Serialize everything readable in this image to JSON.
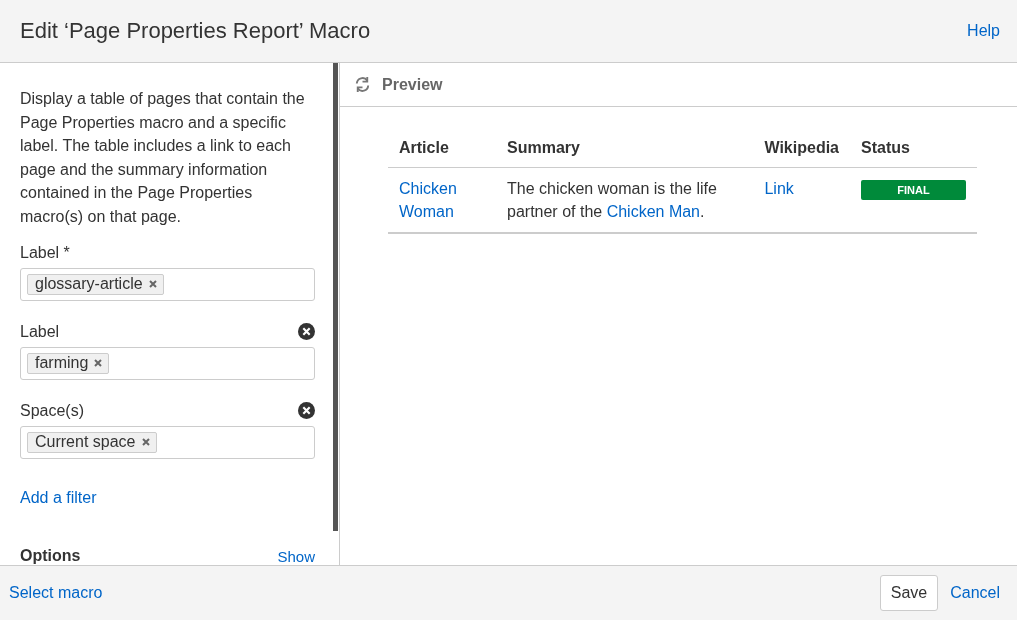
{
  "dialog": {
    "title": "Edit ‘Page Properties Report’ Macro",
    "help": "Help"
  },
  "sidebar": {
    "description": "Display a table of pages that contain the Page Properties macro and a specific label. The table includes a link to each page and the summary information contained in the Page Properties macro(s) on that page.",
    "fields": [
      {
        "label": "Label *",
        "removable": false,
        "tokens": [
          "glossary-article"
        ]
      },
      {
        "label": "Label",
        "removable": true,
        "tokens": [
          "farming"
        ]
      },
      {
        "label": "Space(s)",
        "removable": true,
        "tokens": [
          "Current space"
        ]
      }
    ],
    "add_filter": "Add a filter",
    "options": {
      "title": "Options",
      "toggle": "Show"
    }
  },
  "preview": {
    "title": "Preview",
    "table": {
      "columns": [
        "Article",
        "Summary",
        "Wikipedia",
        "Status"
      ],
      "rows": [
        {
          "article": "Chicken Woman",
          "summary": [
            {
              "kind": "text",
              "text": "The chicken woman is the life partner of the "
            },
            {
              "kind": "link",
              "text": "Chicken Man"
            },
            {
              "kind": "text",
              "text": "."
            }
          ],
          "wikipedia": "Link",
          "status": {
            "text": "FINAL",
            "color": "#008a3a"
          }
        }
      ]
    }
  },
  "footer": {
    "select_macro": "Select macro",
    "buttons": [
      {
        "kind": "primary",
        "label": "Save"
      },
      {
        "kind": "link",
        "label": "Cancel"
      }
    ]
  }
}
